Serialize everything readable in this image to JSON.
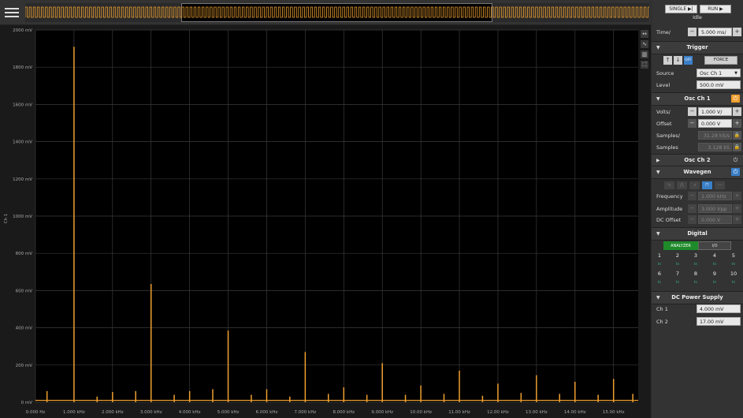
{
  "toolbar": {
    "single_label": "SINGLE ▶|",
    "run_label": "RUN ▶",
    "status": "Idle"
  },
  "time": {
    "label": "Time/",
    "value": "5.000 ms/"
  },
  "trigger": {
    "title": "Trigger",
    "off_label": "OFF",
    "force_label": "FORCE",
    "source_label": "Source",
    "source_value": "Osc Ch 1",
    "level_label": "Level",
    "level_value": "500.0 mV"
  },
  "osc1": {
    "title": "Osc Ch 1",
    "volts_label": "Volts/",
    "volts_value": "1.000 V/",
    "offset_label": "Offset",
    "offset_value": "0.000 V",
    "samples_rate_label": "Samples/",
    "samples_rate_value": "31.28 kS/s",
    "samples_label": "Samples",
    "samples_value": "3.128 kS"
  },
  "osc2": {
    "title": "Osc Ch 2"
  },
  "wavegen": {
    "title": "Wavegen",
    "frequency_label": "Frequency",
    "frequency_value": "1.000 kHz",
    "amplitude_label": "Amplitude",
    "amplitude_value": "3.000 Vpp",
    "dcoffset_label": "DC Offset",
    "dcoffset_value": "0.000 V"
  },
  "digital": {
    "title": "Digital",
    "analyzer_label": "ANALYZER",
    "io_label": "I/O",
    "pins": [
      "1",
      "2",
      "3",
      "4",
      "5",
      "6",
      "7",
      "8",
      "9",
      "10"
    ],
    "pin_state": "In"
  },
  "dcps": {
    "title": "DC Power Supply",
    "ch1_label": "Ch 1",
    "ch1_value": "4.000 mV",
    "ch2_label": "Ch 2",
    "ch2_value": "17.00 mV"
  },
  "colors": {
    "trace": "#f0a030",
    "accent": "#3a7fc8",
    "power_on": "#f0a030"
  },
  "chart_data": {
    "type": "line",
    "ylabel": "Ch 1",
    "xlabel": "",
    "yticks": [
      "0 mV",
      "200 mV",
      "400 mV",
      "600 mV",
      "800 mV",
      "1000 mV",
      "1200 mV",
      "1400 mV",
      "1600 mV",
      "1800 mV",
      "2000 mV"
    ],
    "xticks": [
      "0.000 Hz",
      "1.000 kHz",
      "2.000 kHz",
      "3.000 kHz",
      "4.000 kHz",
      "5.000 kHz",
      "6.000 kHz",
      "7.000 kHz",
      "8.000 kHz",
      "9.000 kHz",
      "10.00 kHz",
      "11.00 kHz",
      "12.00 kHz",
      "13.00 kHz",
      "14.00 kHz",
      "15.00 kHz"
    ],
    "xlim": [
      0,
      15640
    ],
    "ylim": [
      0,
      2000
    ],
    "grid": true,
    "series": [
      {
        "x": [
          300,
          1000,
          1600,
          2000,
          2600,
          3000,
          3600,
          4000,
          4600,
          5000,
          5600,
          6000,
          6600,
          7000,
          7600,
          8000,
          8600,
          9000,
          9600,
          10000,
          10600,
          11000,
          11600,
          12000,
          12600,
          13000,
          13600,
          14000,
          14600,
          15000,
          15500
        ],
        "y": [
          60,
          1910,
          30,
          55,
          60,
          635,
          40,
          60,
          70,
          385,
          40,
          70,
          30,
          270,
          45,
          80,
          40,
          210,
          40,
          90,
          45,
          170,
          35,
          100,
          50,
          145,
          45,
          110,
          40,
          125,
          45
        ]
      }
    ]
  }
}
